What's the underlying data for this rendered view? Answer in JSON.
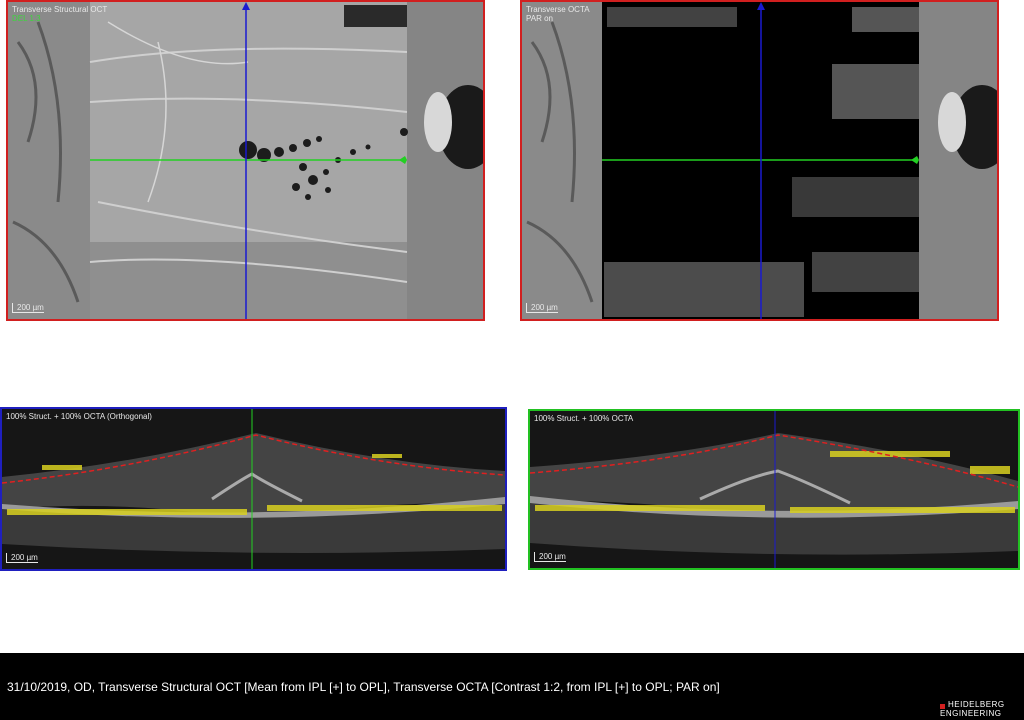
{
  "panels": {
    "structural": {
      "title": "Transverse Structural OCT",
      "subtitle": "DEL 1:3",
      "scale": "200 µm",
      "border_color": "#d11f1f"
    },
    "octa": {
      "title": "Transverse OCTA",
      "subtitle": "PAR on",
      "scale": "200 µm",
      "border_color": "#d11f1f"
    },
    "bscan_orthogonal": {
      "title": "100% Struct. + 100% OCTA (Orthogonal)",
      "scale": "200 µm",
      "border_color": "#1f1fbf"
    },
    "bscan": {
      "title": "100% Struct. + 100% OCTA",
      "scale": "200 µm",
      "border_color": "#22c122"
    }
  },
  "footer": {
    "caption": "31/10/2019, OD, Transverse Structural OCT [Mean from IPL [+] to OPL], Transverse OCTA [Contrast 1:2, from IPL [+] to OPL; PAR on]",
    "logo_line1": "HEIDELBERG",
    "logo_line2": "ENGINEERING"
  },
  "colors": {
    "horizontal_marker": "#22d022",
    "vertical_marker": "#1a1ad0",
    "segmentation_line": "#e02020",
    "flow_overlay": "#e0e020"
  }
}
